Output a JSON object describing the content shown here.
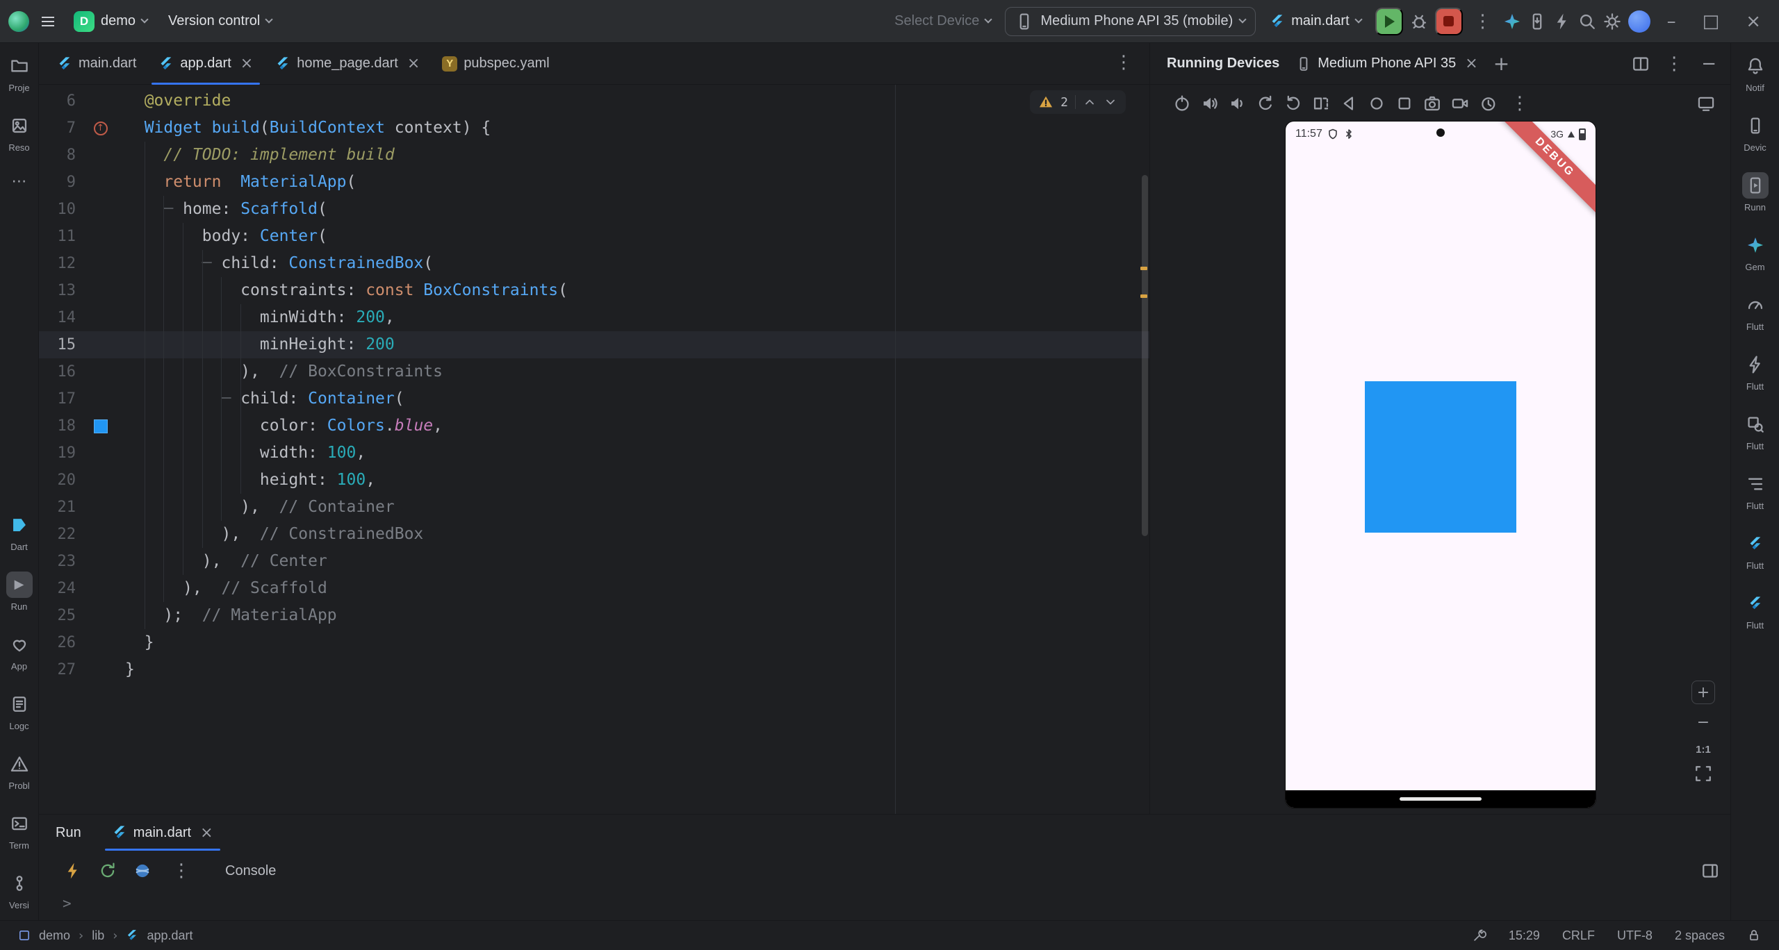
{
  "title_bar": {
    "project_badge": "D",
    "project_name": "demo",
    "version_control": "Version control",
    "select_device": "Select Device",
    "device_selector": "Medium Phone API 35 (mobile)",
    "run_config": "main.dart",
    "icons": [
      "android-studio-logo",
      "main-menu",
      "run",
      "debug",
      "stop",
      "more-actions",
      "ai-assistant",
      "device-manager",
      "apply-changes",
      "search",
      "settings",
      "user-avatar",
      "minimize",
      "maximize",
      "close"
    ]
  },
  "left_stripe": {
    "top": [
      {
        "icon": "project-folder-icon",
        "label": "Proje"
      },
      {
        "icon": "resource-manager-icon",
        "label": "Reso"
      },
      {
        "icon": "more-tool-windows-icon",
        "label": ""
      }
    ],
    "bottom": [
      {
        "icon": "dart-analysis-icon",
        "label": "Dart"
      },
      {
        "icon": "run-icon",
        "label": "Run",
        "selected": true
      },
      {
        "icon": "app-insights-icon",
        "label": "App"
      },
      {
        "icon": "logcat-icon",
        "label": "Logc"
      },
      {
        "icon": "problems-icon",
        "label": "Probl"
      },
      {
        "icon": "terminal-icon",
        "label": "Term"
      },
      {
        "icon": "version-control-icon",
        "label": "Versi"
      }
    ]
  },
  "right_stripe": {
    "items": [
      {
        "icon": "notifications-icon",
        "label": "Notif"
      },
      {
        "icon": "device-manager-icon",
        "label": "Devic"
      },
      {
        "icon": "running-devices-icon",
        "label": "Runn",
        "selected": true
      },
      {
        "icon": "gemini-icon",
        "label": "Gem"
      },
      {
        "icon": "flutter-performance-icon",
        "label": "Flutt"
      },
      {
        "icon": "flutter-bolt-icon",
        "label": "Flutt"
      },
      {
        "icon": "flutter-inspector-icon",
        "label": "Flutt"
      },
      {
        "icon": "flutter-outline-icon",
        "label": "Flutt"
      },
      {
        "icon": "flutter-icon",
        "label": "Flutt"
      },
      {
        "icon": "flutter-icon",
        "label": "Flutt"
      }
    ]
  },
  "editor": {
    "tabs": [
      {
        "label": "main.dart",
        "active": false,
        "closable": false
      },
      {
        "label": "app.dart",
        "active": true,
        "closable": true
      },
      {
        "label": "home_page.dart",
        "active": false,
        "closable": true
      },
      {
        "label": "pubspec.yaml",
        "active": false,
        "closable": false
      }
    ],
    "yaml_icon_letter": "Y",
    "inspections": {
      "warnings": "2"
    },
    "current_line": 15,
    "gutter": {
      "override_marker_line": 7,
      "color_swatch_line": 18,
      "color_swatch": "#2196F3"
    },
    "lines": [
      {
        "n": 6,
        "t": [
          [
            "d",
            "  "
          ],
          [
            "an",
            "@override"
          ]
        ]
      },
      {
        "n": 7,
        "t": [
          [
            "d",
            "  "
          ],
          [
            "t",
            "Widget"
          ],
          [
            "d",
            " "
          ],
          [
            "t",
            "build"
          ],
          [
            "d",
            "("
          ],
          [
            "t",
            "BuildContext"
          ],
          [
            "d",
            " context) {"
          ]
        ]
      },
      {
        "n": 8,
        "t": [
          [
            "d",
            "    "
          ],
          [
            "td",
            "// TODO: implement build"
          ]
        ]
      },
      {
        "n": 9,
        "t": [
          [
            "d",
            "    "
          ],
          [
            "k",
            "return"
          ],
          [
            "d",
            "  "
          ],
          [
            "t",
            "MaterialApp"
          ],
          [
            "d",
            "("
          ]
        ]
      },
      {
        "n": 10,
        "t": [
          [
            "d",
            "    "
          ],
          [
            "g",
            "─ "
          ],
          [
            "d",
            "home: "
          ],
          [
            "t",
            "Scaffold"
          ],
          [
            "d",
            "("
          ]
        ]
      },
      {
        "n": 11,
        "t": [
          [
            "d",
            "        body: "
          ],
          [
            "t",
            "Center"
          ],
          [
            "d",
            "("
          ]
        ]
      },
      {
        "n": 12,
        "t": [
          [
            "d",
            "        "
          ],
          [
            "g",
            "─ "
          ],
          [
            "d",
            "child: "
          ],
          [
            "t",
            "ConstrainedBox"
          ],
          [
            "d",
            "("
          ]
        ]
      },
      {
        "n": 13,
        "t": [
          [
            "d",
            "            constraints: "
          ],
          [
            "k",
            "const"
          ],
          [
            "d",
            " "
          ],
          [
            "t",
            "BoxConstraints"
          ],
          [
            "d",
            "("
          ]
        ]
      },
      {
        "n": 14,
        "t": [
          [
            "d",
            "              minWidth: "
          ],
          [
            "nu",
            "200"
          ],
          [
            "d",
            ","
          ]
        ]
      },
      {
        "n": 15,
        "t": [
          [
            "d",
            "              minHeight: "
          ],
          [
            "nu",
            "200"
          ]
        ]
      },
      {
        "n": 16,
        "t": [
          [
            "d",
            "            ),  "
          ],
          [
            "cm",
            "// BoxConstraints"
          ]
        ]
      },
      {
        "n": 17,
        "t": [
          [
            "d",
            "          "
          ],
          [
            "g",
            "─ "
          ],
          [
            "d",
            "child: "
          ],
          [
            "t",
            "Container"
          ],
          [
            "d",
            "("
          ]
        ]
      },
      {
        "n": 18,
        "t": [
          [
            "d",
            "              color: "
          ],
          [
            "t",
            "Colors"
          ],
          [
            "d",
            "."
          ],
          [
            "pr",
            "blue"
          ],
          [
            "d",
            ","
          ]
        ]
      },
      {
        "n": 19,
        "t": [
          [
            "d",
            "              width: "
          ],
          [
            "nu",
            "100"
          ],
          [
            "d",
            ","
          ]
        ]
      },
      {
        "n": 20,
        "t": [
          [
            "d",
            "              height: "
          ],
          [
            "nu",
            "100"
          ],
          [
            "d",
            ","
          ]
        ]
      },
      {
        "n": 21,
        "t": [
          [
            "d",
            "            ),  "
          ],
          [
            "cm",
            "// Container"
          ]
        ]
      },
      {
        "n": 22,
        "t": [
          [
            "d",
            "          ),  "
          ],
          [
            "cm",
            "// ConstrainedBox"
          ]
        ]
      },
      {
        "n": 23,
        "t": [
          [
            "d",
            "        ),  "
          ],
          [
            "cm",
            "// Center"
          ]
        ]
      },
      {
        "n": 24,
        "t": [
          [
            "d",
            "      ),  "
          ],
          [
            "cm",
            "// Scaffold"
          ]
        ]
      },
      {
        "n": 25,
        "t": [
          [
            "d",
            "    );  "
          ],
          [
            "cm",
            "// MaterialApp"
          ]
        ]
      },
      {
        "n": 26,
        "t": [
          [
            "d",
            "  }"
          ]
        ]
      },
      {
        "n": 27,
        "t": [
          [
            "d",
            "}"
          ]
        ]
      }
    ]
  },
  "run_panel": {
    "title": "Run",
    "tab_label": "main.dart",
    "console_tab": "Console",
    "prompt": ">",
    "toolbar_icons": [
      "hot-reload-icon",
      "hot-restart-icon",
      "devtools-icon",
      "more-icon",
      "layout-settings-icon"
    ]
  },
  "devices_panel": {
    "title": "Running Devices",
    "tab_label": "Medium Phone API 35",
    "toolbar_icons": [
      "power-icon",
      "volume-up-icon",
      "volume-down-icon",
      "rotate-left-icon",
      "rotate-right-icon",
      "fold-icon",
      "back-icon",
      "home-icon",
      "overview-icon",
      "camera-icon",
      "screen-record-icon",
      "snapshot-icon",
      "more-icon",
      "mirror-settings-icon"
    ],
    "zoom_label": "1:1",
    "device_screen": {
      "status_time": "11:57",
      "network": "3G",
      "debug_banner": "DEBUG",
      "app_background": "#FEF7FF",
      "box_color": "#2196F3"
    }
  },
  "status_bar": {
    "crumb_project": "demo",
    "crumb_dir": "lib",
    "crumb_file": "app.dart",
    "caret_position": "15:29",
    "line_separator": "CRLF",
    "encoding": "UTF-8",
    "indent": "2 spaces"
  },
  "colors": {
    "accent": "#3574F0",
    "flutter_blue": "#54C5F8",
    "warning": "#D9A343",
    "run_green": "#63B667",
    "stop_red": "#D4574C"
  }
}
